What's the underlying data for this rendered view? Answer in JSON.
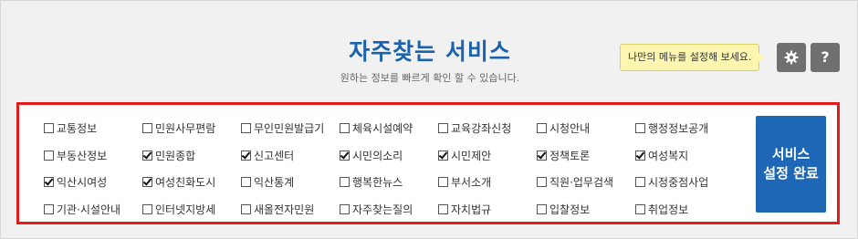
{
  "header": {
    "title": "자주찾는 서비스",
    "subtitle": "원하는 정보를 빠르게 확인 할 수 있습니다."
  },
  "tooltip": {
    "text": "나만의 메뉴를 설정해 보세요."
  },
  "buttons": {
    "settings_icon": "gear-icon",
    "help_label": "?",
    "complete_line1": "서비스",
    "complete_line2": "설정 완료"
  },
  "colors": {
    "accent": "#1b62ad",
    "highlight_border": "#e21b1b",
    "button_bg": "#1e66b6",
    "icon_button_bg": "#707070",
    "tooltip_bg": "#fcf6b1"
  },
  "services": [
    {
      "label": "교통정보",
      "checked": false
    },
    {
      "label": "민원사무편람",
      "checked": false
    },
    {
      "label": "무인민원발급기",
      "checked": false
    },
    {
      "label": "체육시설예약",
      "checked": false
    },
    {
      "label": "교육강좌신청",
      "checked": false
    },
    {
      "label": "시청안내",
      "checked": false
    },
    {
      "label": "행정정보공개",
      "checked": false
    },
    {
      "label": "부동산정보",
      "checked": false
    },
    {
      "label": "민원종합",
      "checked": true
    },
    {
      "label": "신고센터",
      "checked": true
    },
    {
      "label": "시민의소리",
      "checked": true
    },
    {
      "label": "시민제안",
      "checked": true
    },
    {
      "label": "정책토론",
      "checked": true
    },
    {
      "label": "여성복지",
      "checked": true
    },
    {
      "label": "익산시여성",
      "checked": true
    },
    {
      "label": "여성친화도시",
      "checked": true
    },
    {
      "label": "익산통계",
      "checked": false
    },
    {
      "label": "행복한뉴스",
      "checked": false
    },
    {
      "label": "부서소개",
      "checked": false
    },
    {
      "label": "직원·업무검색",
      "checked": false
    },
    {
      "label": "시정중점사업",
      "checked": false
    },
    {
      "label": "기관·시설안내",
      "checked": false
    },
    {
      "label": "인터넷지방세",
      "checked": false
    },
    {
      "label": "새올전자민원",
      "checked": false
    },
    {
      "label": "자주찾는질의",
      "checked": false
    },
    {
      "label": "자치법규",
      "checked": false
    },
    {
      "label": "입찰정보",
      "checked": false
    },
    {
      "label": "취업정보",
      "checked": false
    }
  ]
}
